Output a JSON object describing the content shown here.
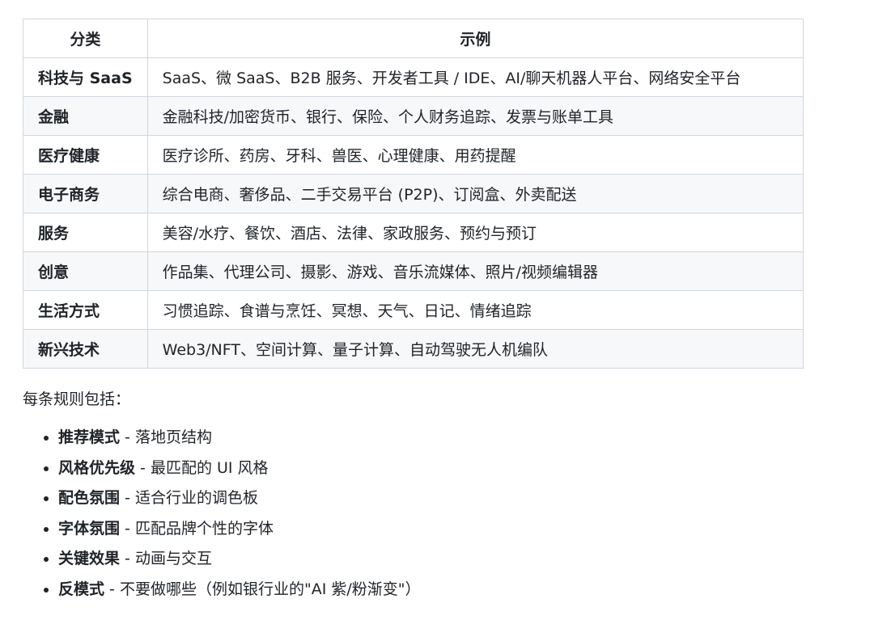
{
  "table": {
    "headers": [
      "分类",
      "示例"
    ],
    "rows": [
      {
        "category": "科技与 SaaS",
        "examples": "SaaS、微 SaaS、B2B 服务、开发者工具 / IDE、AI/聊天机器人平台、网络安全平台"
      },
      {
        "category": "金融",
        "examples": "金融科技/加密货币、银行、保险、个人财务追踪、发票与账单工具"
      },
      {
        "category": "医疗健康",
        "examples": "医疗诊所、药房、牙科、兽医、心理健康、用药提醒"
      },
      {
        "category": "电子商务",
        "examples": "综合电商、奢侈品、二手交易平台 (P2P)、订阅盒、外卖配送"
      },
      {
        "category": "服务",
        "examples": "美容/水疗、餐饮、酒店、法律、家政服务、预约与预订"
      },
      {
        "category": "创意",
        "examples": "作品集、代理公司、摄影、游戏、音乐流媒体、照片/视频编辑器"
      },
      {
        "category": "生活方式",
        "examples": "习惯追踪、食谱与烹饪、冥想、天气、日记、情绪追踪"
      },
      {
        "category": "新兴技术",
        "examples": "Web3/NFT、空间计算、量子计算、自动驾驶无人机编队"
      }
    ]
  },
  "intro": "每条规则包括：",
  "rules": [
    {
      "term": "推荐模式",
      "desc": " - 落地页结构"
    },
    {
      "term": "风格优先级",
      "desc": " - 最匹配的 UI 风格"
    },
    {
      "term": "配色氛围",
      "desc": " - 适合行业的调色板"
    },
    {
      "term": "字体氛围",
      "desc": " - 匹配品牌个性的字体"
    },
    {
      "term": "关键效果",
      "desc": " - 动画与交互"
    },
    {
      "term": "反模式",
      "desc": " - 不要做哪些（例如银行业的\"AI 紫/粉渐变\"）"
    }
  ]
}
